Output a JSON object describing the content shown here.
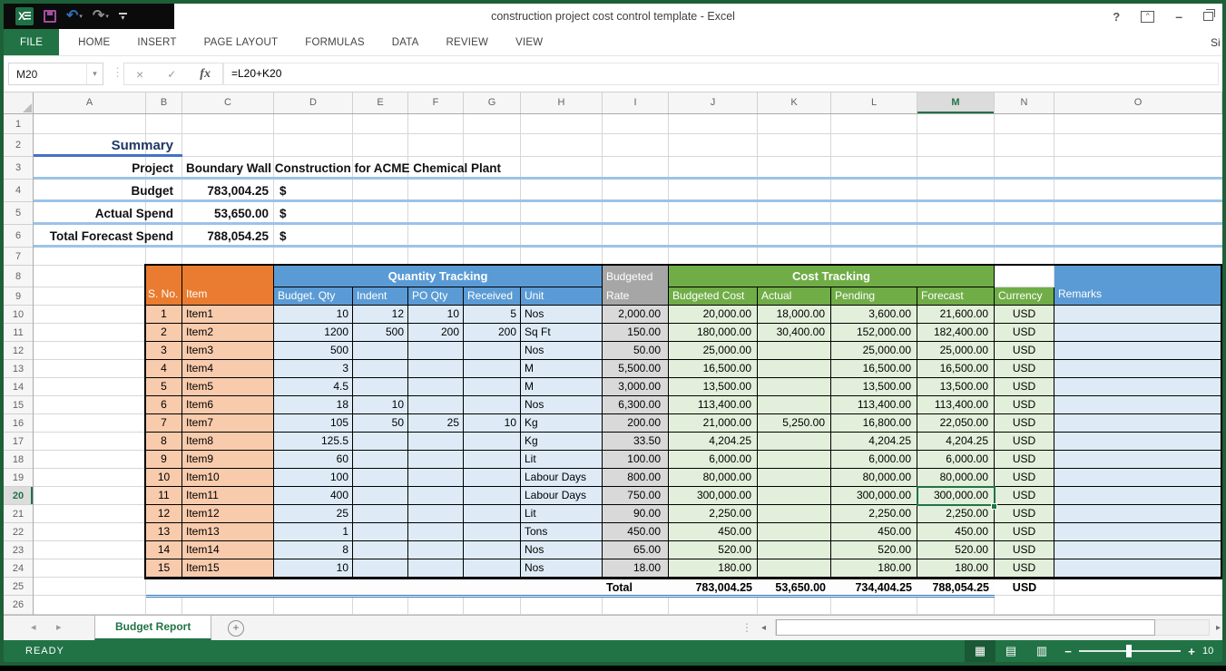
{
  "window": {
    "title": "construction project cost control template - Excel",
    "sign_in_label": "Si",
    "qat_icons": [
      "excel-logo",
      "save",
      "undo",
      "redo",
      "customize-quick-access-toolbar"
    ],
    "window_controls": [
      "help",
      "ribbon-display-options",
      "minimize",
      "restore-down"
    ]
  },
  "ribbon": {
    "tabs": [
      {
        "label": "FILE",
        "active": true
      },
      {
        "label": "HOME",
        "active": false
      },
      {
        "label": "INSERT",
        "active": false
      },
      {
        "label": "PAGE LAYOUT",
        "active": false
      },
      {
        "label": "FORMULAS",
        "active": false
      },
      {
        "label": "DATA",
        "active": false
      },
      {
        "label": "REVIEW",
        "active": false
      },
      {
        "label": "VIEW",
        "active": false
      }
    ]
  },
  "formula_bar": {
    "name_box": "M20",
    "formula": "=L20+K20"
  },
  "grid": {
    "column_letters": [
      "A",
      "B",
      "C",
      "D",
      "E",
      "F",
      "G",
      "H",
      "I",
      "J",
      "K",
      "L",
      "M",
      "N",
      "O"
    ],
    "row_numbers": [
      "1",
      "2",
      "3",
      "4",
      "5",
      "6",
      "7",
      "8",
      "9",
      "10",
      "11",
      "12",
      "13",
      "14",
      "15",
      "16",
      "17",
      "18",
      "19",
      "20",
      "21",
      "22",
      "23",
      "24",
      "25",
      "26"
    ],
    "selected_cell": "M20",
    "selected_column": "M",
    "selected_row": "20"
  },
  "summary": {
    "title": "Summary",
    "rows": [
      {
        "label": "Project",
        "value": "Boundary Wall Construction for ACME Chemical Plant",
        "currency": ""
      },
      {
        "label": "Budget",
        "value": "783,004.25",
        "currency": "$"
      },
      {
        "label": "Actual Spend",
        "value": "53,650.00",
        "currency": "$"
      },
      {
        "label": "Total Forecast Spend",
        "value": "788,054.25",
        "currency": "$"
      }
    ]
  },
  "table": {
    "merged_headers": {
      "sno": "S. No.",
      "item": "Item",
      "quantity_tracking": "Quantity Tracking",
      "budgeted_rate": "Budgeted Rate",
      "cost_tracking": "Cost Tracking",
      "remarks": "Remarks"
    },
    "quantity_columns": [
      "Budget. Qty",
      "Indent",
      "PO Qty",
      "Received",
      "Unit"
    ],
    "cost_columns": [
      "Budgeted Cost",
      "Actual",
      "Pending",
      "Forecast",
      "Currency"
    ],
    "rows": [
      [
        "1",
        "Item1",
        "10",
        "12",
        "10",
        "5",
        "Nos",
        "2,000.00",
        "20,000.00",
        "18,000.00",
        "3,600.00",
        "21,600.00",
        "USD",
        ""
      ],
      [
        "2",
        "Item2",
        "1200",
        "500",
        "200",
        "200",
        "Sq Ft",
        "150.00",
        "180,000.00",
        "30,400.00",
        "152,000.00",
        "182,400.00",
        "USD",
        ""
      ],
      [
        "3",
        "Item3",
        "500",
        "",
        "",
        "",
        "Nos",
        "50.00",
        "25,000.00",
        "",
        "25,000.00",
        "25,000.00",
        "USD",
        ""
      ],
      [
        "4",
        "Item4",
        "3",
        "",
        "",
        "",
        "M",
        "5,500.00",
        "16,500.00",
        "",
        "16,500.00",
        "16,500.00",
        "USD",
        ""
      ],
      [
        "5",
        "Item5",
        "4.5",
        "",
        "",
        "",
        "M",
        "3,000.00",
        "13,500.00",
        "",
        "13,500.00",
        "13,500.00",
        "USD",
        ""
      ],
      [
        "6",
        "Item6",
        "18",
        "10",
        "",
        "",
        "Nos",
        "6,300.00",
        "113,400.00",
        "",
        "113,400.00",
        "113,400.00",
        "USD",
        ""
      ],
      [
        "7",
        "Item7",
        "105",
        "50",
        "25",
        "10",
        "Kg",
        "200.00",
        "21,000.00",
        "5,250.00",
        "16,800.00",
        "22,050.00",
        "USD",
        ""
      ],
      [
        "8",
        "Item8",
        "125.5",
        "",
        "",
        "",
        "Kg",
        "33.50",
        "4,204.25",
        "",
        "4,204.25",
        "4,204.25",
        "USD",
        ""
      ],
      [
        "9",
        "Item9",
        "60",
        "",
        "",
        "",
        "Lit",
        "100.00",
        "6,000.00",
        "",
        "6,000.00",
        "6,000.00",
        "USD",
        ""
      ],
      [
        "10",
        "Item10",
        "100",
        "",
        "",
        "",
        "Labour Days",
        "800.00",
        "80,000.00",
        "",
        "80,000.00",
        "80,000.00",
        "USD",
        ""
      ],
      [
        "11",
        "Item11",
        "400",
        "",
        "",
        "",
        "Labour Days",
        "750.00",
        "300,000.00",
        "",
        "300,000.00",
        "300,000.00",
        "USD",
        ""
      ],
      [
        "12",
        "Item12",
        "25",
        "",
        "",
        "",
        "Lit",
        "90.00",
        "2,250.00",
        "",
        "2,250.00",
        "2,250.00",
        "USD",
        ""
      ],
      [
        "13",
        "Item13",
        "1",
        "",
        "",
        "",
        "Tons",
        "450.00",
        "450.00",
        "",
        "450.00",
        "450.00",
        "USD",
        ""
      ],
      [
        "14",
        "Item14",
        "8",
        "",
        "",
        "",
        "Nos",
        "65.00",
        "520.00",
        "",
        "520.00",
        "520.00",
        "USD",
        ""
      ],
      [
        "15",
        "Item15",
        "10",
        "",
        "",
        "",
        "Nos",
        "18.00",
        "180.00",
        "",
        "180.00",
        "180.00",
        "USD",
        ""
      ]
    ],
    "total_row": {
      "label": "Total",
      "budgeted_cost": "783,004.25",
      "actual": "53,650.00",
      "pending": "734,404.25",
      "forecast": "788,054.25",
      "currency": "USD"
    }
  },
  "sheet_bar": {
    "tabs": [
      {
        "label": "Budget Report",
        "active": true
      }
    ],
    "new_sheet_label": "+"
  },
  "status_bar": {
    "mode": "READY",
    "zoom_label": "10",
    "view_icons": [
      "normal-view",
      "page-layout-view",
      "page-break-preview"
    ]
  },
  "icons": {
    "excel_x": "X",
    "dropdown": "▾",
    "dots": "⋮",
    "cancel": "×",
    "enter": "✓",
    "fx": "fx",
    "undo": "↶",
    "redo": "↷",
    "help": "?",
    "ribbon_display": "^",
    "minimize": "–",
    "sheet_prev": "◂",
    "sheet_next": "▸",
    "scroll_left": "◂",
    "scroll_right": "▸",
    "zoom_minus": "−",
    "zoom_plus": "+",
    "normal_view": "▦",
    "page_layout_view": "▤",
    "page_break_view": "▥"
  },
  "colors": {
    "excel_green": "#217346",
    "header_orange": "#E97C30",
    "header_blue": "#5B9BD5",
    "header_gray": "#A6A6A6",
    "header_green": "#70AD47",
    "row_peach": "#F8CBAD",
    "row_light_blue": "#DEEBF7",
    "row_light_gray": "#D9D9D9",
    "row_light_green": "#E2EFDA",
    "summary_line_blue": "#9DC3E6",
    "summary_underline_blue": "#4472C4",
    "total_underline_blue": "#2E75B6",
    "selection_green": "#217346"
  }
}
